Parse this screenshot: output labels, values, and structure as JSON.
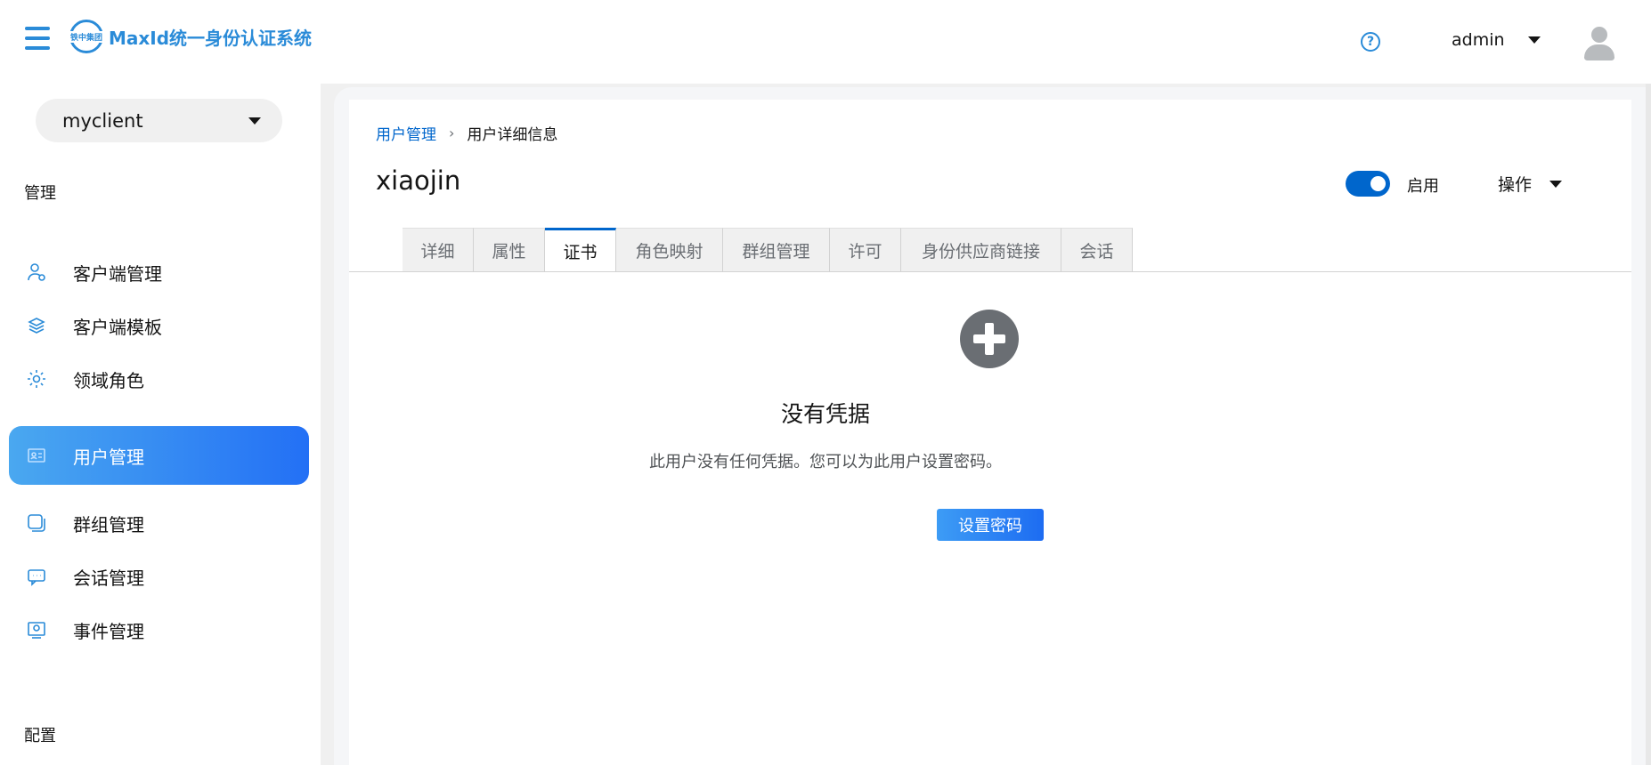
{
  "header": {
    "logo_mark_text": "铁中集团",
    "app_title": "MaxId统一身份认证系统",
    "user_name": "admin",
    "help_icon": "question-circle-icon",
    "avatar_icon": "user-avatar-icon"
  },
  "sidebar": {
    "client_select": {
      "value": "myclient"
    },
    "section_manage": "管理",
    "items": [
      {
        "label": "客户端管理",
        "icon": "user-shield-icon"
      },
      {
        "label": "客户端模板",
        "icon": "layers-icon"
      },
      {
        "label": "领域角色",
        "icon": "gear-icon"
      },
      {
        "label": "用户管理",
        "icon": "users-card-icon",
        "active": true
      },
      {
        "label": "群组管理",
        "icon": "group-icon"
      },
      {
        "label": "会话管理",
        "icon": "chat-icon"
      },
      {
        "label": "事件管理",
        "icon": "event-icon"
      }
    ],
    "section_config": "配置"
  },
  "breadcrumb": {
    "parent": "用户管理",
    "current": "用户详细信息"
  },
  "page": {
    "title": "xiaojin",
    "enabled_label": "启用",
    "enabled": true,
    "action_label": "操作"
  },
  "tabs": [
    {
      "label": "详细"
    },
    {
      "label": "属性"
    },
    {
      "label": "证书",
      "active": true
    },
    {
      "label": "角色映射"
    },
    {
      "label": "群组管理"
    },
    {
      "label": "许可"
    },
    {
      "label": "身份供应商链接"
    },
    {
      "label": "会话"
    }
  ],
  "empty_state": {
    "icon": "plus-circle-icon",
    "title": "没有凭据",
    "body": "此用户没有任何凭据。您可以为此用户设置密码。",
    "button_label": "设置密码"
  },
  "colors": {
    "accent": "#2a8bd8",
    "link": "#0066cc",
    "active_nav_start": "#4aa8f0",
    "active_nav_end": "#2370f5"
  }
}
